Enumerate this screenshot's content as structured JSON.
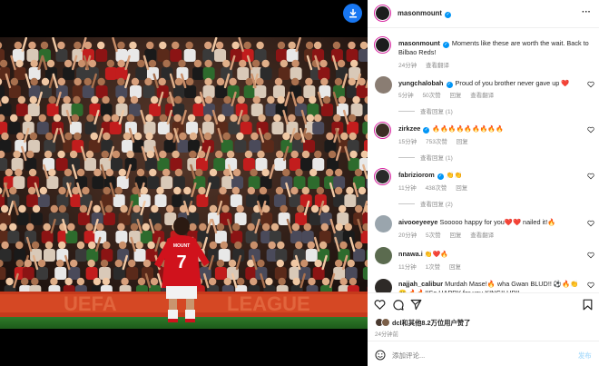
{
  "post": {
    "author": "masonmount",
    "caption": "Moments like these are worth the wait. Back to Bilbao Reds!",
    "time": "24分钟",
    "see_translation": "查看翻译",
    "likes_text": "dcl和其他8.2万位用户赞了",
    "time_ago": "24分钟前",
    "comment_placeholder": "添加评论...",
    "post_button": "发布"
  },
  "photo": {
    "player_number": "7",
    "player_name": "MOUNT"
  },
  "comments": [
    {
      "user": "yungchalobah",
      "verified": true,
      "text": "Proud of you brother never gave up ❤️",
      "time": "5分钟",
      "likes": "50次赞",
      "reply": "回复",
      "translate": "查看翻译",
      "replies": "查看回复 (1)"
    },
    {
      "user": "zirkzee",
      "verified": true,
      "text": "🔥🔥🔥🔥🔥🔥🔥🔥🔥",
      "time": "15分钟",
      "likes": "753次赞",
      "reply": "回复",
      "translate": "",
      "replies": "查看回复 (1)"
    },
    {
      "user": "fabriziorom",
      "verified": true,
      "text": "👏👏",
      "time": "11分钟",
      "likes": "438次赞",
      "reply": "回复",
      "translate": "",
      "replies": "查看回复 (2)"
    },
    {
      "user": "aivooeyeeye",
      "verified": false,
      "text": "Sooooo happy for you❤️❤️ nailed it!🔥",
      "time": "20分钟",
      "likes": "5次赞",
      "reply": "回复",
      "translate": "查看翻译",
      "replies": ""
    },
    {
      "user": "nnawa.i",
      "verified": false,
      "text": "👏❤️🔥",
      "time": "11分钟",
      "likes": "1次赞",
      "reply": "回复",
      "translate": "",
      "replies": ""
    },
    {
      "user": "najjah_calibur",
      "verified": false,
      "text": "Murdah Mase!🔥 wha Gwan BLUD!! ⚽🔥👏😊 🔥🔥!!So HAPPY for you KING!! UP!!",
      "time": "",
      "likes": "",
      "reply": "",
      "translate": "",
      "replies": ""
    }
  ],
  "colors": {
    "accent": "#0095f6",
    "like_red": "#ed4956",
    "download_blue": "#1877f2"
  }
}
